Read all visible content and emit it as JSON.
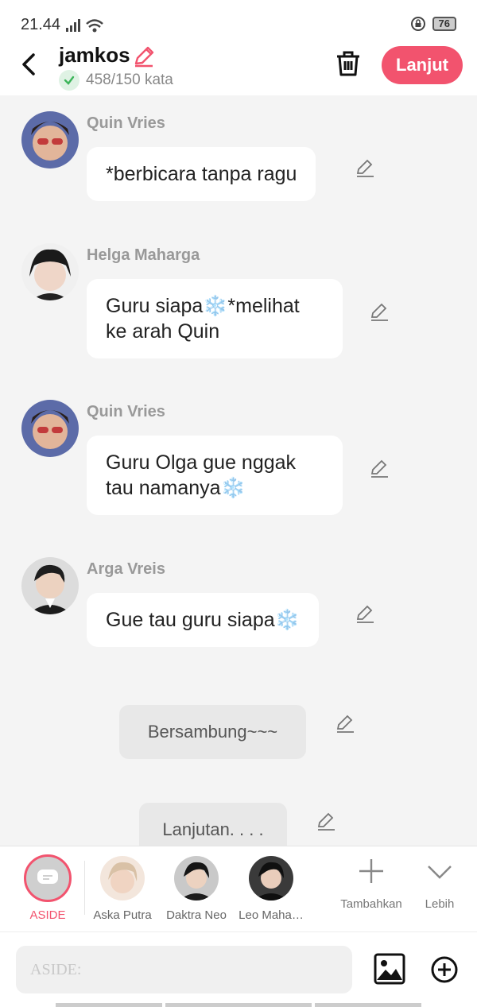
{
  "status": {
    "time": "21.44",
    "battery": "76"
  },
  "header": {
    "title": "jamkos",
    "word_count": "458/150 kata",
    "next_label": "Lanjut"
  },
  "messages": [
    {
      "name": "Quin Vries",
      "text": "*berbicara tanpa ragu"
    },
    {
      "name": "Helga Maharga",
      "line1": "Guru siapa❄️*melihat",
      "line2": "ke arah Quin"
    },
    {
      "name": "Quin Vries",
      "line1": "Guru Olga gue nggak",
      "line2": "tau namanya❄️"
    },
    {
      "name": "Arga Vreis",
      "text": "Gue tau guru siapa❄️"
    }
  ],
  "system_messages": [
    "Bersambung~~~",
    "Lanjutan. . . ."
  ],
  "characters": {
    "aside_label": "ASIDE",
    "items": [
      "Aska Putra",
      "Daktra Neo",
      "Leo Maha…"
    ],
    "add_label": "Tambahkan",
    "more_label": "Lebih"
  },
  "input": {
    "placeholder": "ASIDE:"
  },
  "colors": {
    "accent": "#f2536e",
    "check": "#3cb55a"
  }
}
